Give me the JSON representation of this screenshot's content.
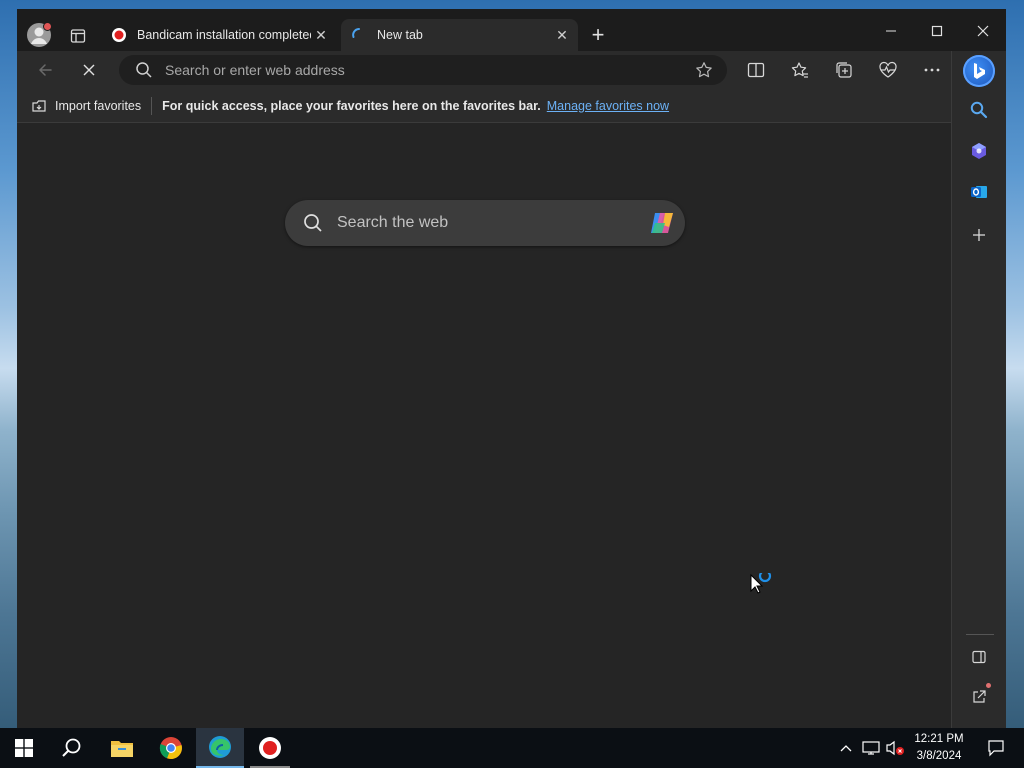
{
  "browser": {
    "tabs": [
      {
        "title": "Bandicam installation completed",
        "close_label": "✕",
        "active": false
      },
      {
        "title": "New tab",
        "close_label": "✕",
        "active": true
      }
    ],
    "new_tab_label": "+",
    "window_controls": {
      "minimize": "—",
      "maximize": "☐",
      "close": "✕"
    }
  },
  "toolbar": {
    "address_placeholder": "Search or enter web address"
  },
  "favorites_bar": {
    "import_label": "Import favorites",
    "message": "For quick access, place your favorites here on the favorites bar.",
    "manage_link": "Manage favorites now"
  },
  "new_tab_page": {
    "search_placeholder": "Search the web"
  },
  "taskbar": {
    "time": "12:21 PM",
    "date": "3/8/2024"
  },
  "colors": {
    "accent": "#0a84d8",
    "link": "#6cb1f5",
    "record_red": "#e02020"
  },
  "icons": [
    "profile-icon",
    "workspaces-icon",
    "bandicam-record-icon",
    "loading-spinner-icon",
    "back-arrow-icon",
    "stop-loading-icon",
    "search-icon",
    "favorite-star-icon",
    "split-screen-icon",
    "favorites-icon",
    "collections-icon",
    "browser-essentials-icon",
    "more-menu-icon",
    "bing-copilot-icon",
    "copilot-colorful-icon",
    "sidebar-search-icon",
    "sidebar-copilot-icon",
    "outlook-icon",
    "add-sidebar-app-icon",
    "hide-sidebar-icon",
    "open-external-icon",
    "settings-icon",
    "windows-start-icon",
    "taskbar-search-icon",
    "file-explorer-icon",
    "chrome-icon",
    "edge-icon",
    "bandicam-taskbar-icon",
    "tray-chevron-icon",
    "network-icon",
    "volume-muted-icon",
    "notifications-icon",
    "busy-cursor-icon"
  ]
}
